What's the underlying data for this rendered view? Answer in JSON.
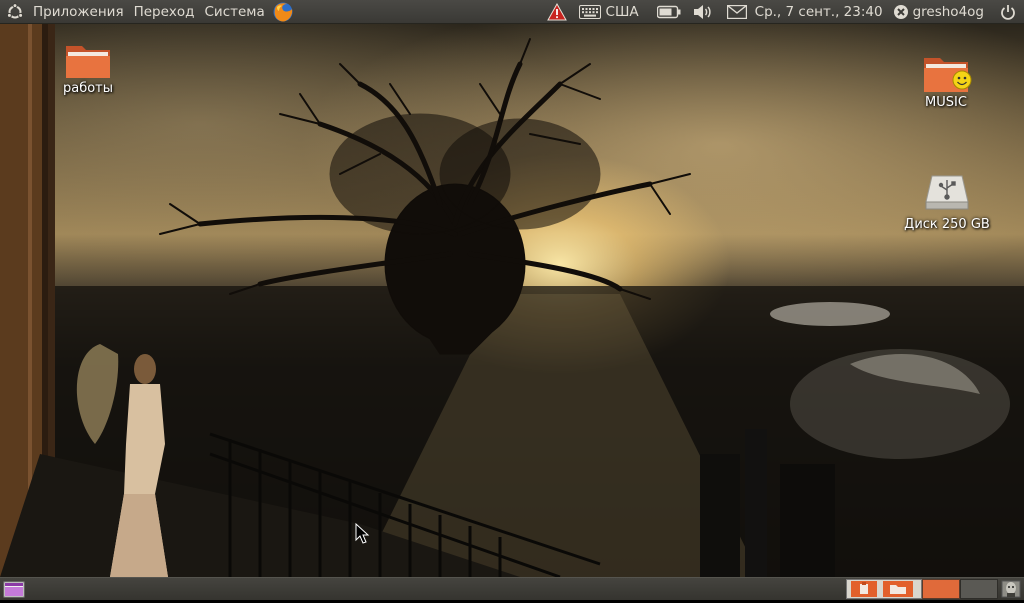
{
  "top_panel": {
    "menus": [
      "Приложения",
      "Переход",
      "Система"
    ],
    "keyboard_layout": "США",
    "datetime": "Ср., 7 сент., 23:40",
    "username": "gresho4og",
    "icons": [
      "ubuntu-logo-icon",
      "firefox-icon",
      "warning-icon",
      "keyboard-icon",
      "battery-icon",
      "volume-icon",
      "mail-icon",
      "user-status-icon",
      "power-icon"
    ]
  },
  "desktop": {
    "icons": [
      {
        "label": "работы",
        "type": "folder"
      },
      {
        "label": "MUSIC",
        "type": "folder-emblem-smile"
      },
      {
        "label": "Диск 250 GB",
        "type": "usb-drive"
      }
    ]
  },
  "bottom_panel": {
    "icons": [
      "show-desktop-icon",
      "workspace-switcher",
      "window-button-icons",
      "trash-icon"
    ]
  },
  "colors": {
    "panel": "#3c3b37",
    "folder": "#e06a3a",
    "accent": "#dd4814"
  }
}
